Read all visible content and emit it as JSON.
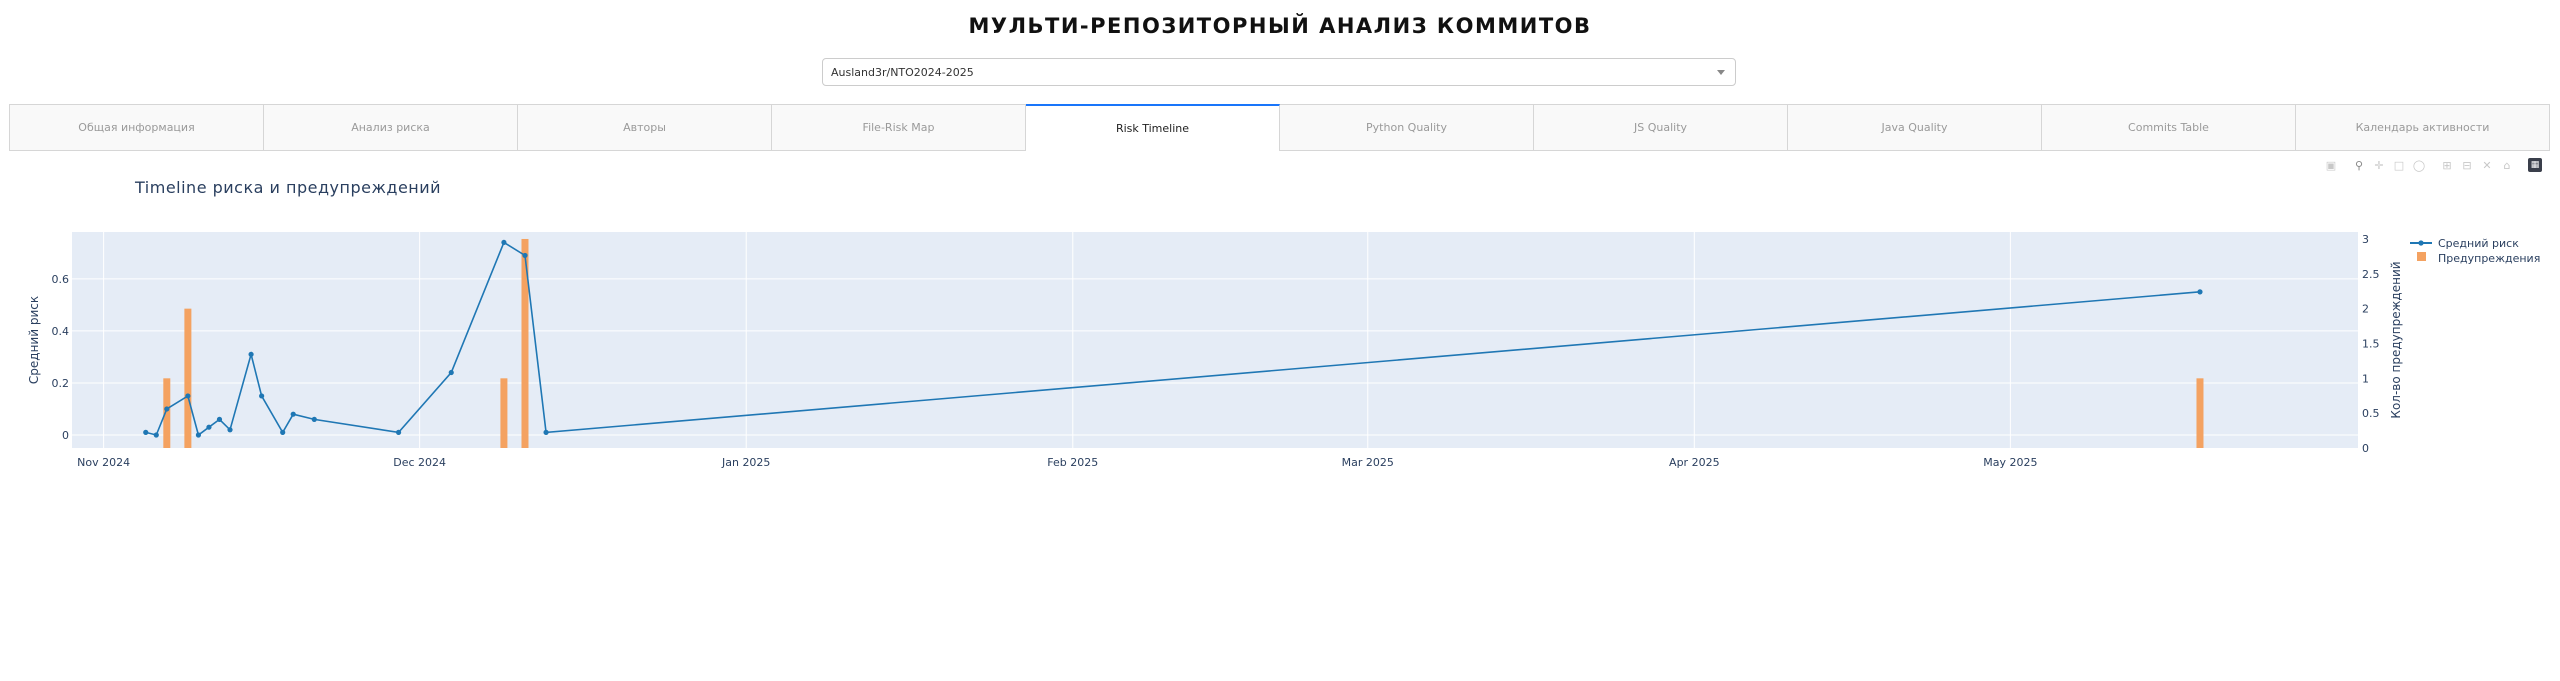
{
  "page": {
    "title": "МУЛЬТИ-РЕПОЗИТОРНЫЙ АНАЛИЗ КОММИТОВ"
  },
  "repo_select": {
    "value": "Ausland3r/NTO2024-2025"
  },
  "tabs": [
    {
      "label": "Общая информация",
      "active": false
    },
    {
      "label": "Анализ риска",
      "active": false
    },
    {
      "label": "Авторы",
      "active": false
    },
    {
      "label": "File-Risk Map",
      "active": false
    },
    {
      "label": "Risk Timeline",
      "active": true
    },
    {
      "label": "Python Quality",
      "active": false
    },
    {
      "label": "JS Quality",
      "active": false
    },
    {
      "label": "Java Quality",
      "active": false
    },
    {
      "label": "Commits Table",
      "active": false
    },
    {
      "label": "Календарь активности",
      "active": false
    }
  ],
  "modebar": [
    "camera-icon",
    "zoom-icon",
    "pan-icon",
    "box-select-icon",
    "lasso-icon",
    "zoom-in-icon",
    "zoom-out-icon",
    "autoscale-icon",
    "reset-axes-icon",
    "plotly-logo-icon"
  ],
  "colors": {
    "risk_line": "#1f77b4",
    "warnings_bar": "#f4a261",
    "plot_bg": "#e5ecf6",
    "active_tab_border": "#1975fa"
  },
  "chart_data": {
    "type": "line",
    "title": "Timeline риска и предупреждений",
    "ylabel": "Средний риск",
    "y2label": "Кол-во предупреждений",
    "xlim": [
      "2024-10-29",
      "2025-06-03"
    ],
    "ylim": [
      -0.05,
      0.78
    ],
    "y2lim": [
      0,
      3.1
    ],
    "x_ticks": [
      {
        "date": "2024-11-01",
        "label": "Nov 2024"
      },
      {
        "date": "2024-12-01",
        "label": "Dec 2024"
      },
      {
        "date": "2025-01-01",
        "label": "Jan 2025"
      },
      {
        "date": "2025-02-01",
        "label": "Feb 2025"
      },
      {
        "date": "2025-03-01",
        "label": "Mar 2025"
      },
      {
        "date": "2025-04-01",
        "label": "Apr 2025"
      },
      {
        "date": "2025-05-01",
        "label": "May 2025"
      }
    ],
    "y_ticks": [
      0,
      0.2,
      0.4,
      0.6
    ],
    "y_tick_labels": [
      "0",
      "0.2",
      "0.4",
      "0.6"
    ],
    "y2_ticks": [
      0,
      0.5,
      1,
      1.5,
      2,
      2.5,
      3
    ],
    "y2_tick_labels": [
      "0",
      "0.5",
      "1",
      "1.5",
      "2",
      "2.5",
      "3"
    ],
    "grid": true,
    "legend_placement": "top-right",
    "series": [
      {
        "name": "Средний риск",
        "kind": "line+markers",
        "points": [
          {
            "x": "2024-11-05",
            "y": 0.01
          },
          {
            "x": "2024-11-06",
            "y": 0.0
          },
          {
            "x": "2024-11-07",
            "y": 0.1
          },
          {
            "x": "2024-11-09",
            "y": 0.15
          },
          {
            "x": "2024-11-10",
            "y": 0.0
          },
          {
            "x": "2024-11-11",
            "y": 0.03
          },
          {
            "x": "2024-11-12",
            "y": 0.06
          },
          {
            "x": "2024-11-13",
            "y": 0.02
          },
          {
            "x": "2024-11-15",
            "y": 0.31
          },
          {
            "x": "2024-11-16",
            "y": 0.15
          },
          {
            "x": "2024-11-18",
            "y": 0.01
          },
          {
            "x": "2024-11-19",
            "y": 0.08
          },
          {
            "x": "2024-11-21",
            "y": 0.06
          },
          {
            "x": "2024-11-29",
            "y": 0.01
          },
          {
            "x": "2024-12-04",
            "y": 0.24
          },
          {
            "x": "2024-12-09",
            "y": 0.74
          },
          {
            "x": "2024-12-11",
            "y": 0.69
          },
          {
            "x": "2024-12-13",
            "y": 0.01
          },
          {
            "x": "2025-05-19",
            "y": 0.55
          }
        ]
      },
      {
        "name": "Предупреждения",
        "kind": "bar",
        "axis": "y2",
        "points": [
          {
            "x": "2024-11-07",
            "y": 1
          },
          {
            "x": "2024-11-09",
            "y": 2
          },
          {
            "x": "2024-12-09",
            "y": 1
          },
          {
            "x": "2024-12-11",
            "y": 3
          },
          {
            "x": "2025-05-19",
            "y": 1
          }
        ]
      }
    ]
  }
}
